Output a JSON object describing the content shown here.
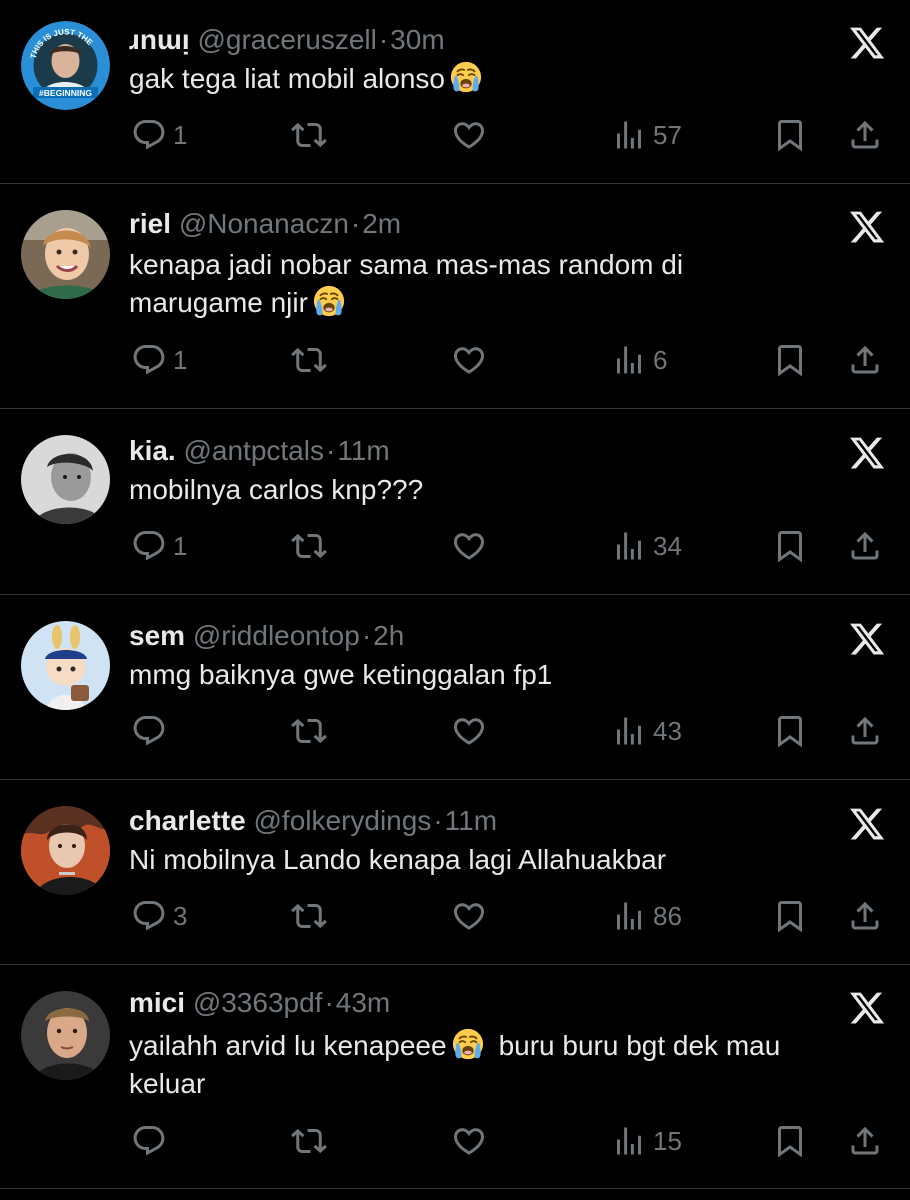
{
  "tweets": [
    {
      "name": "ɹnɯᴉ",
      "handle": "@graceruszell",
      "time": "30m",
      "text": "gak tega liat mobil alonso",
      "emoji": "loudly-crying-face",
      "replies": "1",
      "views": "57",
      "avatar_caption_top": "THIS IS JUST THE",
      "avatar_caption_bottom": "#BEGINNING"
    },
    {
      "name": "riel",
      "handle": "@Nonanaczn",
      "time": "2m",
      "text_lines": [
        "kenapa jadi nobar sama mas-mas random di",
        "marugame njir"
      ],
      "emoji": "loudly-crying-face",
      "replies": "1",
      "views": "6"
    },
    {
      "name": "kia.",
      "handle": "@antpctals",
      "time": "11m",
      "text": "mobilnya carlos knp???",
      "replies": "1",
      "views": "34"
    },
    {
      "name": "sem",
      "handle": "@riddleontop",
      "time": "2h",
      "text": "mmg baiknya gwe ketinggalan fp1",
      "replies": "",
      "views": "43"
    },
    {
      "name": "charlette",
      "handle": "@folkerydings",
      "time": "11m",
      "text": "Ni mobilnya Lando kenapa lagi Allahuakbar",
      "replies": "3",
      "views": "86"
    },
    {
      "name": "mici",
      "handle": "@3363pdf",
      "time": "43m",
      "text_line1_a": "yailahh arvid lu kenapeee",
      "text_line1_b": "buru buru bgt dek mau",
      "text_line2": "keluar",
      "emoji": "loudly-crying-face",
      "replies": "",
      "views": "15"
    }
  ],
  "separator": "·",
  "colors": {
    "background": "#000000",
    "primary_text": "#e7e9ea",
    "secondary_text": "#71767b",
    "divider": "#2f3336"
  },
  "icons": [
    "reply-icon",
    "retweet-icon",
    "like-icon",
    "views-icon",
    "bookmark-icon",
    "share-icon",
    "x-logo-icon"
  ]
}
